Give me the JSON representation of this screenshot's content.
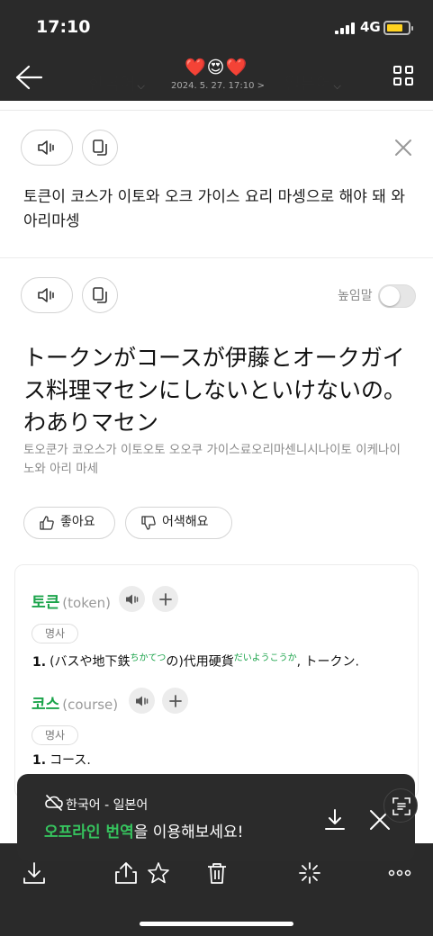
{
  "status_bar": {
    "time": "17:10",
    "network": "4G"
  },
  "header": {
    "source_language": "한국어",
    "target_language": "일본어",
    "reaction": "❤️😍❤️",
    "date": "2024. 5. 27. 17:10 >"
  },
  "source": {
    "text": "토큰이 코스가 이토와 오크 가이스 요리 마셍으로 해야 돼 와 아리마셍"
  },
  "translation": {
    "honorific_label": "높임말",
    "honorific_on": false,
    "text": "トークンがコースが伊藤とオークガイス料理マセンにしないといけないの。わありマセン",
    "pronunciation": "토오쿤가 코오스가 이토오토 오오쿠 가이스료오리마센니시나이토 이케나이노와 아리 마세",
    "like_label": "좋아요",
    "dislike_label": "어색해요"
  },
  "dictionary": {
    "entries": [
      {
        "word": "토큰",
        "origin": "(token)",
        "pos": "명사",
        "def_num": "1.",
        "def_before": "(バスや地下鉄",
        "furigana1": "ちかてつ",
        "def_middle": "の)代用硬貨",
        "furigana2": "だいようこうか",
        "def_after": ", トークン."
      },
      {
        "word": "코스",
        "origin": "(course)",
        "pos": "명사",
        "def_num": "1.",
        "def_text": "コース."
      }
    ]
  },
  "offline_banner": {
    "languages": "한국어 - 일본어",
    "highlight": "오프라인 번역",
    "message_rest": "을 이용해보세요!"
  },
  "colors": {
    "accent_green": "#1aa34a",
    "dark_bar": "#2a2a2a",
    "battery": "#ffd21f"
  }
}
